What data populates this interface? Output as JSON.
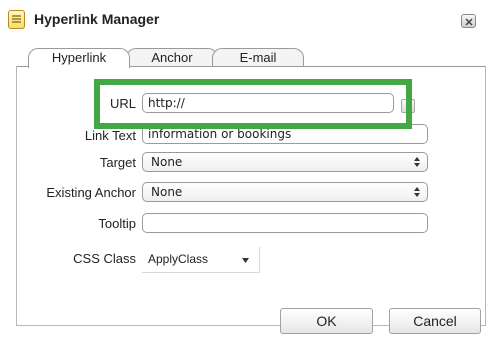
{
  "dialog": {
    "title": "Hyperlink Manager",
    "icons": {
      "title": "document-icon",
      "close": "close-icon"
    }
  },
  "tabs": [
    {
      "label": "Hyperlink",
      "active": true
    },
    {
      "label": "Anchor",
      "active": false
    },
    {
      "label": "E-mail",
      "active": false
    }
  ],
  "form": {
    "url": {
      "label": "URL",
      "value": "http://"
    },
    "link_text": {
      "label": "Link Text",
      "value": "information or bookings"
    },
    "target": {
      "label": "Target",
      "value": "None"
    },
    "existing_anchor": {
      "label": "Existing Anchor",
      "value": "None"
    },
    "tooltip": {
      "label": "Tooltip",
      "value": ""
    },
    "css_class": {
      "label": "CSS Class",
      "value": "ApplyClass"
    }
  },
  "buttons": {
    "ok": "OK",
    "cancel": "Cancel"
  },
  "colors": {
    "highlight": "#43a843"
  }
}
